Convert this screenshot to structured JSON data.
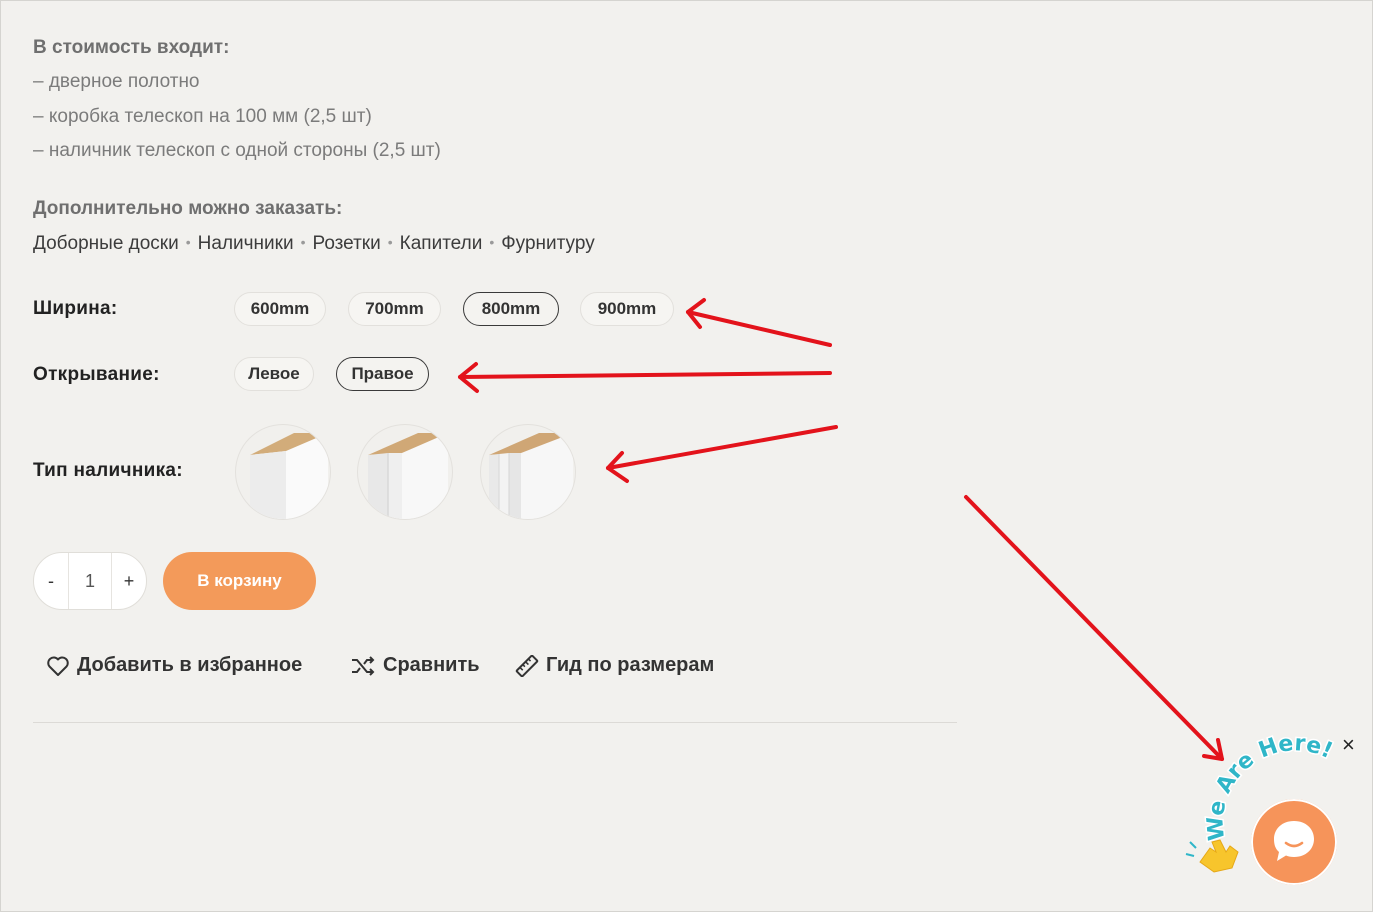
{
  "included": {
    "heading": "В стоимость входит:",
    "items": [
      "– дверное полотно",
      "– коробка телескоп на 100 мм (2,5 шт)",
      "– наличник телескоп с одной стороны (2,5 шт)"
    ]
  },
  "extra": {
    "heading": "Дополнительно можно заказать:",
    "links": [
      "Доборные доски",
      "Наличники",
      "Розетки",
      "Капители",
      "Фурнитуру"
    ],
    "separator": "•"
  },
  "options": {
    "width_label": "Ширина:",
    "widths": [
      "600mm",
      "700mm",
      "800mm",
      "900mm"
    ],
    "selected_width": "800mm",
    "opening_label": "Открывание:",
    "openings": [
      "Левое",
      "Правое"
    ],
    "selected_opening": "Правое",
    "trim_label": "Тип наличника:"
  },
  "cart": {
    "minus": "-",
    "quantity": "1",
    "plus": "+",
    "add_to_cart": "В корзину"
  },
  "actions": {
    "wishlist": "Добавить в избранное",
    "compare": "Сравнить",
    "size_guide": "Гид по размерам"
  },
  "chat_widget": {
    "badge_text": "We Are Here!",
    "close": "×"
  },
  "colors": {
    "accent": "#f39a5a",
    "annotation_arrows": "#e3131b",
    "background": "#f2f1ee"
  }
}
